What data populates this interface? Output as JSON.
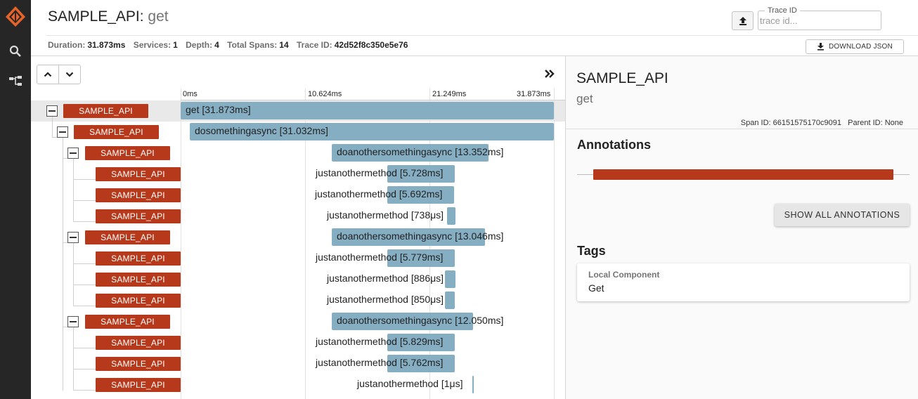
{
  "header": {
    "service": "SAMPLE_API",
    "separator": ":",
    "method": " get",
    "stats": [
      {
        "key": "Duration:",
        "value": "31.873ms"
      },
      {
        "key": "Services:",
        "value": "1"
      },
      {
        "key": "Depth:",
        "value": "4"
      },
      {
        "key": "Total Spans:",
        "value": "14"
      },
      {
        "key": "Trace ID:",
        "value": "42d52f8c350e5e76"
      }
    ],
    "trace_id_label": "Trace ID",
    "trace_id_placeholder": "trace id...",
    "download_label": "DOWNLOAD JSON"
  },
  "nav": {
    "icons": [
      "logo-icon",
      "search-icon",
      "dependencies-icon"
    ]
  },
  "timeline": {
    "ticks": [
      "0ms",
      "10.624ms",
      "21.249ms",
      "31.873ms"
    ]
  },
  "spans": [
    {
      "service": "SAMPLE_API",
      "label": "get [31.873ms]"
    },
    {
      "service": "SAMPLE_API",
      "label": "dosomethingasync [31.032ms]"
    },
    {
      "service": "SAMPLE_API",
      "label": "doanothersomethingasync [13.352ms]"
    },
    {
      "service": "SAMPLE_API",
      "label": "justanothermethod [5.728ms]"
    },
    {
      "service": "SAMPLE_API",
      "label": "justanothermethod [5.692ms]"
    },
    {
      "service": "SAMPLE_API",
      "label": "justanothermethod [738μs]"
    },
    {
      "service": "SAMPLE_API",
      "label": "doanothersomethingasync [13.046ms]"
    },
    {
      "service": "SAMPLE_API",
      "label": "justanothermethod [5.779ms]"
    },
    {
      "service": "SAMPLE_API",
      "label": "justanothermethod [886μs]"
    },
    {
      "service": "SAMPLE_API",
      "label": "justanothermethod [850μs]"
    },
    {
      "service": "SAMPLE_API",
      "label": "doanothersomethingasync [12.050ms]"
    },
    {
      "service": "SAMPLE_API",
      "label": "justanothermethod [5.829ms]"
    },
    {
      "service": "SAMPLE_API",
      "label": "justanothermethod [5.762ms]"
    },
    {
      "service": "SAMPLE_API",
      "label": "justanothermethod [1μs]"
    }
  ],
  "detail": {
    "service": "SAMPLE_API",
    "name": "get",
    "span_id_label": "Span ID:",
    "span_id": "66151575170c9091",
    "parent_id_label": "Parent ID:",
    "parent_id": "None",
    "annotations_title": "Annotations",
    "show_all_label": "SHOW ALL ANNOTATIONS",
    "tags_title": "Tags",
    "tag": {
      "key": "Local Component",
      "value": "Get"
    }
  },
  "colors": {
    "service_badge": "#b5391a",
    "span_bar": "#85aec3",
    "rail": "#262626"
  }
}
